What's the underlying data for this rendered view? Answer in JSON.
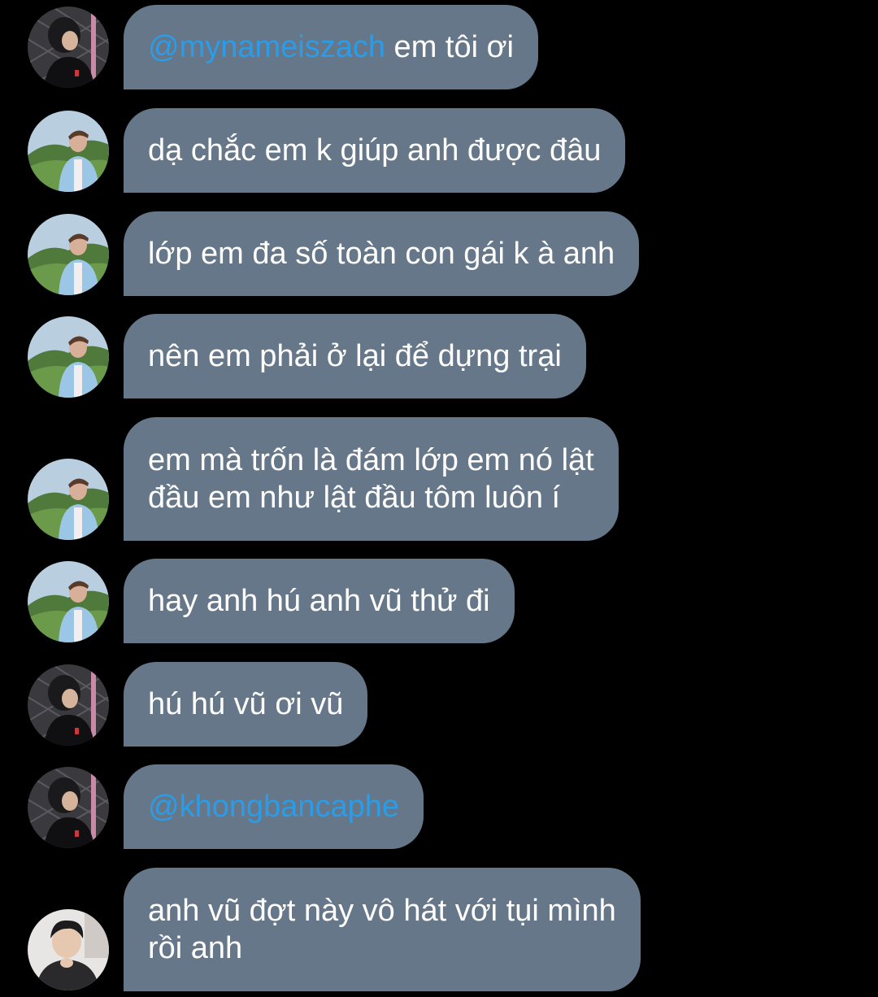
{
  "messages": [
    {
      "avatar": "user-a-avatar",
      "mention": "@mynameiszach",
      "text": " em tôi ơi"
    },
    {
      "avatar": "user-b-avatar",
      "mention": "",
      "text": "dạ chắc em k giúp anh được đâu"
    },
    {
      "avatar": "user-b-avatar",
      "mention": "",
      "text": "lớp em đa số toàn con gái k à anh"
    },
    {
      "avatar": "user-b-avatar",
      "mention": "",
      "text": "nên em phải ở lại để dựng trại"
    },
    {
      "avatar": "user-b-avatar",
      "mention": "",
      "text": "em mà trốn là đám lớp em nó lật\nđầu em như lật đầu tôm luôn í"
    },
    {
      "avatar": "user-b-avatar",
      "mention": "",
      "text": "hay anh hú anh vũ thử đi"
    },
    {
      "avatar": "user-a-avatar",
      "mention": "",
      "text": "hú hú vũ ơi vũ"
    },
    {
      "avatar": "user-a-avatar",
      "mention": "@khongbancaphe",
      "text": ""
    },
    {
      "avatar": "user-c-avatar",
      "mention": "",
      "text": "anh vũ đợt này vô hát với tụi mình\nrồi anh"
    }
  ],
  "colors": {
    "background": "#000000",
    "bubble": "#667789",
    "text": "#ffffff",
    "mention": "#2b9ce8"
  }
}
